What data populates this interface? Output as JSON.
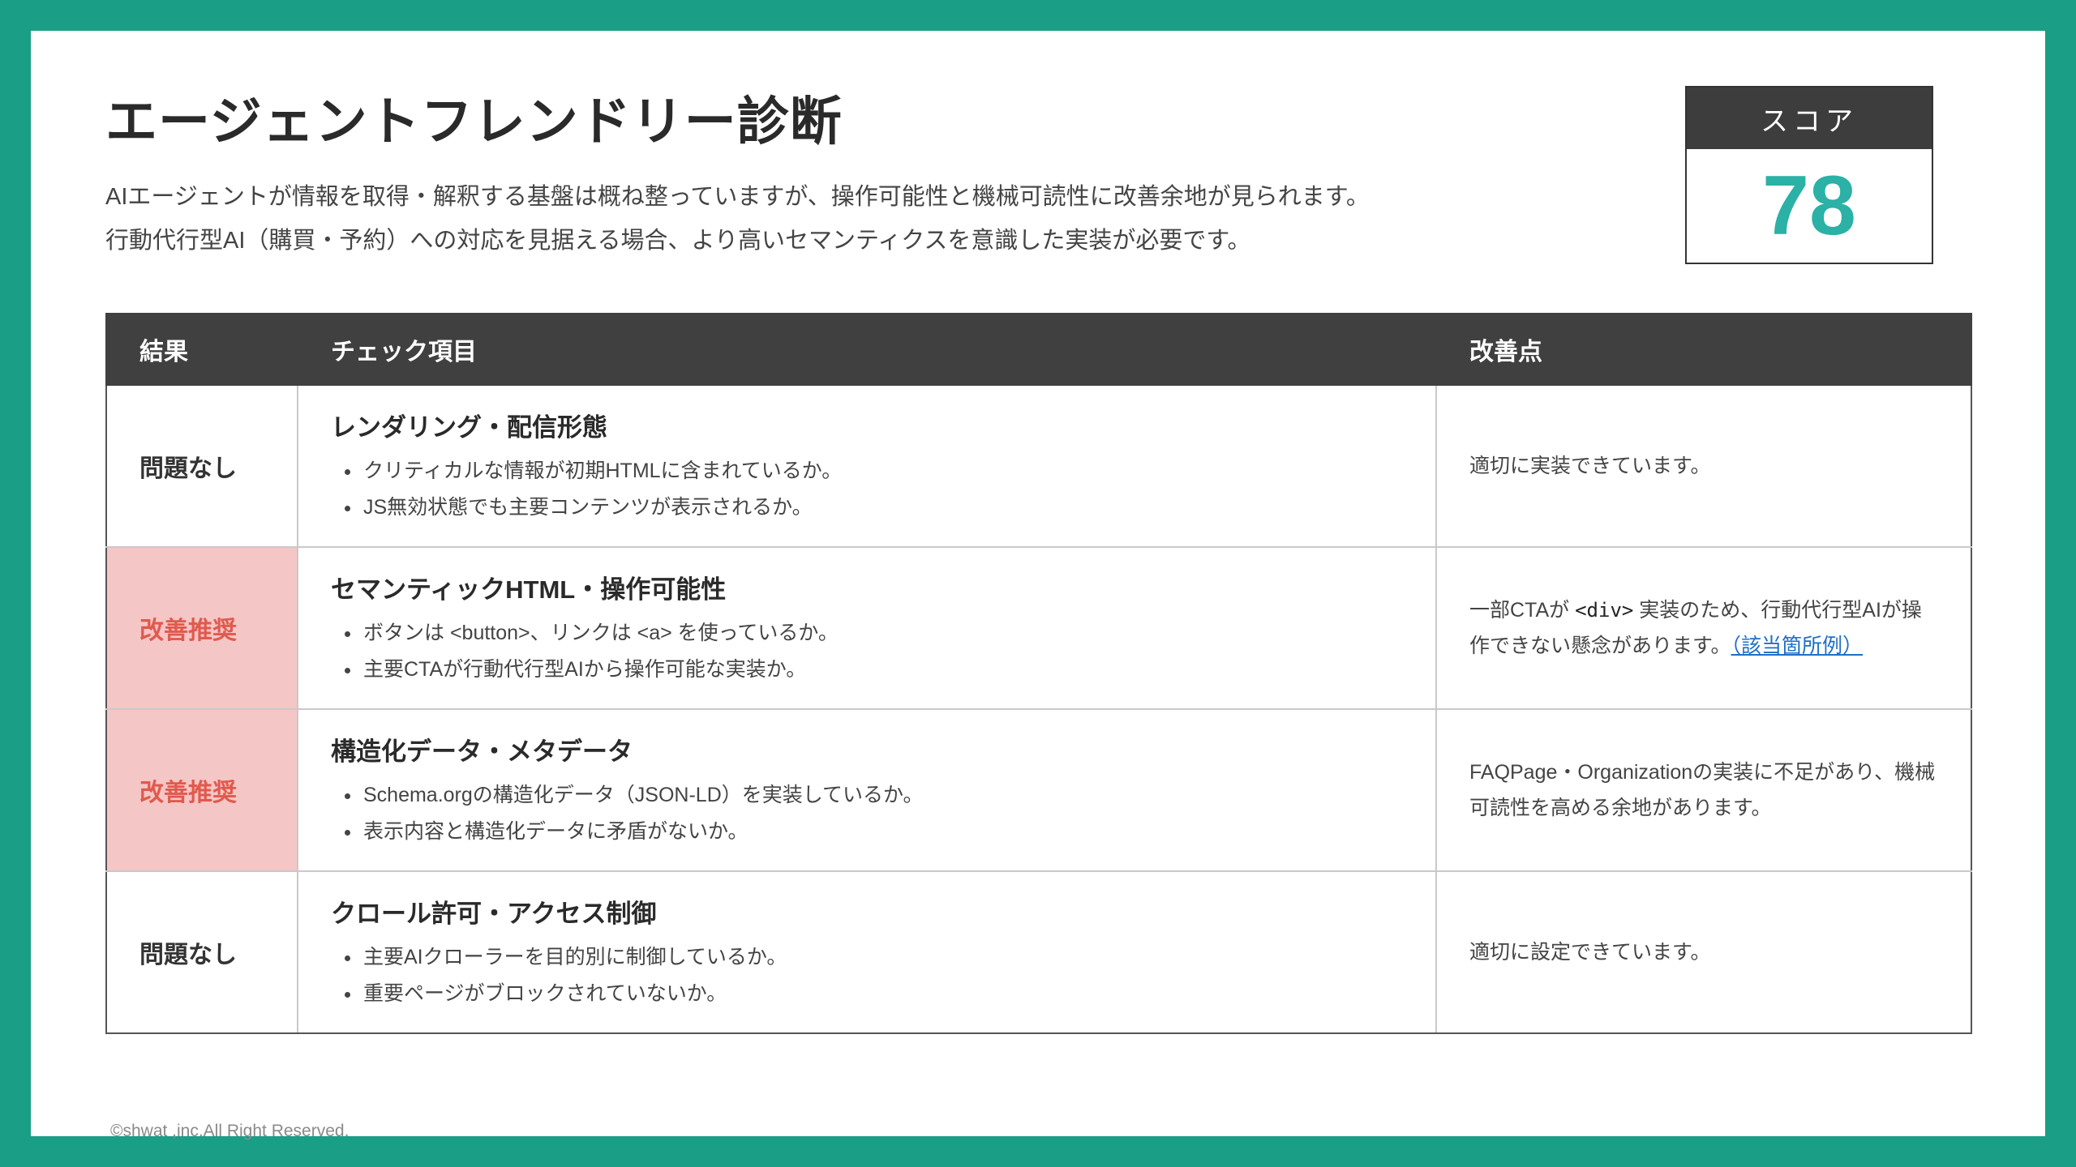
{
  "header": {
    "title": "エージェントフレンドリー診断",
    "summary_line1": "AIエージェントが情報を取得・解釈する基盤は概ね整っていますが、操作可能性と機械可読性に改善余地が見られます。",
    "summary_line2": "行動代行型AI（購買・予約）への対応を見据える場合、より高いセマンティクスを意識した実装が必要です。"
  },
  "score": {
    "label": "スコア",
    "value": "78"
  },
  "table": {
    "headers": [
      "結果",
      "チェック項目",
      "改善点"
    ],
    "rows": [
      {
        "result": "問題なし",
        "title": "レンダリング・配信形態",
        "checks": [
          "クリティカルな情報が初期HTMLに含まれているか。",
          "JS無効状態でも主要コンテンツが表示されるか。"
        ],
        "improvement": "適切に実装できています。"
      },
      {
        "result": "改善推奨",
        "title": "セマンティックHTML・操作可能性",
        "checks": [
          "ボタンは <button>、リンクは <a> を使っているか。",
          "主要CTAが行動代行型AIから操作可能な実装か。"
        ],
        "improvement_pre": "一部CTAが ",
        "improvement_code": "<div>",
        "improvement_post": " 実装のため、行動代行型AIが操作できない懸念があります。",
        "improvement_link": "（該当箇所例）"
      },
      {
        "result": "改善推奨",
        "title": "構造化データ・メタデータ",
        "checks": [
          "Schema.orgの構造化データ（JSON-LD）を実装しているか。",
          "表示内容と構造化データに矛盾がないか。"
        ],
        "improvement": "FAQPage・Organizationの実装に不足があり、機械可読性を高める余地があります。"
      },
      {
        "result": "問題なし",
        "title": "クロール許可・アクセス制御",
        "checks": [
          "主要AIクローラーを目的別に制御しているか。",
          "重要ページがブロックされていないか。"
        ],
        "improvement": "適切に設定できています。"
      }
    ]
  },
  "footer": {
    "copyright": "©shwat ,inc.All Right Reserved."
  }
}
